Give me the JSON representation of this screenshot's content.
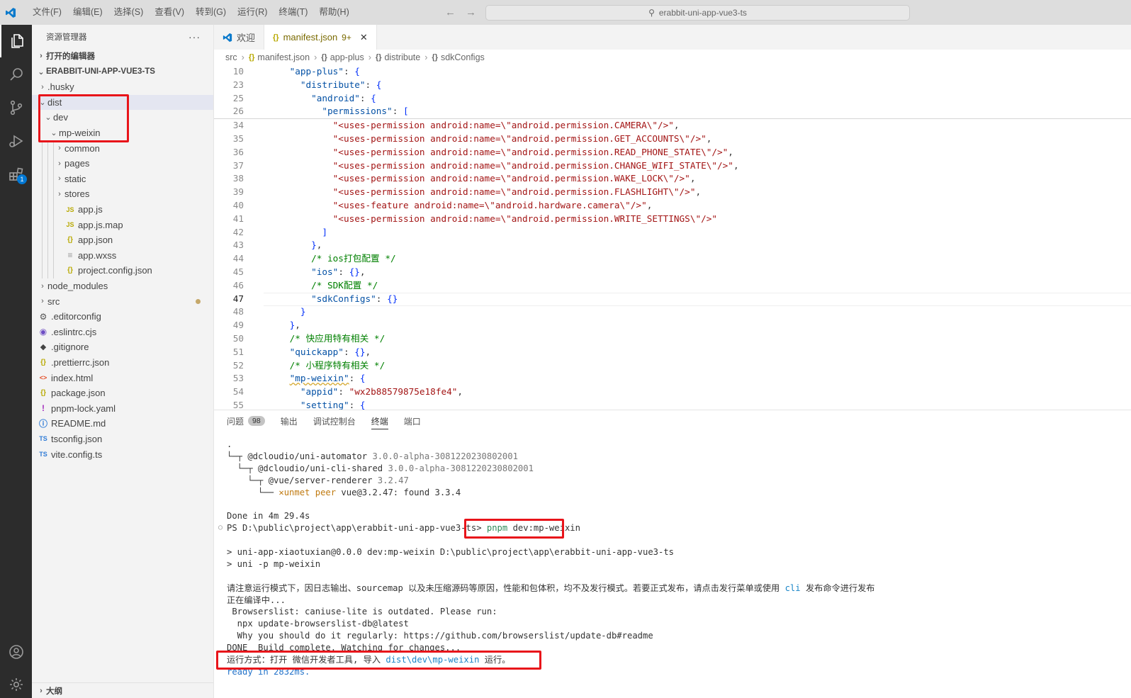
{
  "titlebar": {
    "menus": [
      "文件(F)",
      "编辑(E)",
      "选择(S)",
      "查看(V)",
      "转到(G)",
      "运行(R)",
      "终端(T)",
      "帮助(H)"
    ],
    "search_text": "erabbit-uni-app-vue3-ts"
  },
  "activity_bar": {
    "extensions_badge": "1"
  },
  "sidebar": {
    "title": "资源管理器",
    "more": "···",
    "open_editors": "打开的编辑器",
    "project": "ERABBIT-UNI-APP-VUE3-TS",
    "tree": [
      {
        "label": ".husky",
        "icon": "",
        "chev": "›"
      },
      {
        "label": "dist",
        "icon": "",
        "chev": "⌄"
      },
      {
        "label": "dev",
        "icon": "",
        "chev": "⌄"
      },
      {
        "label": "mp-weixin",
        "icon": "",
        "chev": "⌄"
      },
      {
        "label": "common",
        "icon": "",
        "chev": "›"
      },
      {
        "label": "pages",
        "icon": "",
        "chev": "›"
      },
      {
        "label": "static",
        "icon": "",
        "chev": "›"
      },
      {
        "label": "stores",
        "icon": "",
        "chev": "›"
      },
      {
        "label": "app.js",
        "icon": "JS",
        "chev": ""
      },
      {
        "label": "app.js.map",
        "icon": "JS",
        "chev": ""
      },
      {
        "label": "app.json",
        "icon": "{}",
        "chev": ""
      },
      {
        "label": "app.wxss",
        "icon": "≡",
        "chev": ""
      },
      {
        "label": "project.config.json",
        "icon": "{}",
        "chev": ""
      },
      {
        "label": "node_modules",
        "icon": "",
        "chev": "›"
      },
      {
        "label": "src",
        "icon": "",
        "chev": "›"
      },
      {
        "label": ".editorconfig",
        "icon": "⚙",
        "chev": ""
      },
      {
        "label": ".eslintrc.cjs",
        "icon": "◉",
        "chev": ""
      },
      {
        "label": ".gitignore",
        "icon": "◆",
        "chev": ""
      },
      {
        "label": ".prettierrc.json",
        "icon": "{}",
        "chev": ""
      },
      {
        "label": "index.html",
        "icon": "<>",
        "chev": ""
      },
      {
        "label": "package.json",
        "icon": "{}",
        "chev": ""
      },
      {
        "label": "pnpm-lock.yaml",
        "icon": "!",
        "chev": ""
      },
      {
        "label": "README.md",
        "icon": "ⓘ",
        "chev": ""
      },
      {
        "label": "tsconfig.json",
        "icon": "TS",
        "chev": ""
      },
      {
        "label": "vite.config.ts",
        "icon": "TS",
        "chev": ""
      }
    ],
    "outline": "大纲"
  },
  "tabs": [
    {
      "label": "欢迎"
    },
    {
      "label": "manifest.json",
      "count": "9+",
      "close": "✕"
    }
  ],
  "breadcrumb": [
    "src",
    "manifest.json",
    "app-plus",
    "distribute",
    "sdkConfigs"
  ],
  "code_lines": [
    {
      "n": "10",
      "text": "    \"app-plus\": {"
    },
    {
      "n": "23",
      "text": "      \"distribute\": {"
    },
    {
      "n": "25",
      "text": "        \"android\": {"
    },
    {
      "n": "26",
      "text": "          \"permissions\": ["
    },
    {
      "n": "34",
      "text": "            \"<uses-permission android:name=\\\"android.permission.CAMERA\\\"/>\","
    },
    {
      "n": "35",
      "text": "            \"<uses-permission android:name=\\\"android.permission.GET_ACCOUNTS\\\"/>\","
    },
    {
      "n": "36",
      "text": "            \"<uses-permission android:name=\\\"android.permission.READ_PHONE_STATE\\\"/>\","
    },
    {
      "n": "37",
      "text": "            \"<uses-permission android:name=\\\"android.permission.CHANGE_WIFI_STATE\\\"/>\","
    },
    {
      "n": "38",
      "text": "            \"<uses-permission android:name=\\\"android.permission.WAKE_LOCK\\\"/>\","
    },
    {
      "n": "39",
      "text": "            \"<uses-permission android:name=\\\"android.permission.FLASHLIGHT\\\"/>\","
    },
    {
      "n": "40",
      "text": "            \"<uses-feature android:name=\\\"android.hardware.camera\\\"/>\","
    },
    {
      "n": "41",
      "text": "            \"<uses-permission android:name=\\\"android.permission.WRITE_SETTINGS\\\"/>\""
    },
    {
      "n": "42",
      "text": "          ]"
    },
    {
      "n": "43",
      "text": "        },"
    },
    {
      "n": "44",
      "text": "        /* ios打包配置 */"
    },
    {
      "n": "45",
      "text": "        \"ios\": {},"
    },
    {
      "n": "46",
      "text": "        /* SDK配置 */"
    },
    {
      "n": "47",
      "text": "        \"sdkConfigs\": {}"
    },
    {
      "n": "48",
      "text": "      }"
    },
    {
      "n": "49",
      "text": "    },"
    },
    {
      "n": "50",
      "text": "    /* 快应用特有相关 */"
    },
    {
      "n": "51",
      "text": "    \"quickapp\": {},"
    },
    {
      "n": "52",
      "text": "    /* 小程序特有相关 */"
    },
    {
      "n": "53",
      "text": "    \"mp-weixin\": {"
    },
    {
      "n": "54",
      "text": "      \"appid\": \"wx2b88579875e18fe4\","
    },
    {
      "n": "55",
      "text": "      \"setting\": {"
    }
  ],
  "panel": {
    "tabs": [
      {
        "label": "问题",
        "badge": "98"
      },
      {
        "label": "输出"
      },
      {
        "label": "调试控制台"
      },
      {
        "label": "终端"
      },
      {
        "label": "端口"
      }
    ],
    "terminal": [
      ".",
      "└─┬ @dcloudio/uni-automator 3.0.0-alpha-3081220230802001",
      "  └─┬ @dcloudio/uni-cli-shared 3.0.0-alpha-3081220230802001",
      "    └─┬ @vue/server-renderer 3.2.47",
      "      └── ✕unmet peer vue@3.2.47: found 3.3.4",
      "",
      "Done in 4m 29.4s",
      "PS D:\\public\\project\\app\\erabbit-uni-app-vue3-ts> pnpm dev:mp-weixin",
      "",
      "> uni-app-xiaotuxian@0.0.0 dev:mp-weixin D:\\public\\project\\app\\erabbit-uni-app-vue3-ts",
      "> uni -p mp-weixin",
      "",
      "请注意运行模式下，因日志输出、sourcemap 以及未压缩源码等原因，性能和包体积，均不及发行模式。若要正式发布，请点击发行菜单或使用 cli 发布命令进行发布",
      "正在编译中...",
      " Browserslist: caniuse-lite is outdated. Please run:",
      "  npx update-browserslist-db@latest",
      "  Why you should do it regularly: https://github.com/browserslist/update-db#readme",
      "DONE  Build complete. Watching for changes...",
      "运行方式：打开 微信开发者工具, 导入 dist\\dev\\mp-weixin 运行。",
      "ready in 2832ms."
    ]
  },
  "colors": {
    "red_highlight": "#e8141a",
    "accent": "#0078d4"
  }
}
